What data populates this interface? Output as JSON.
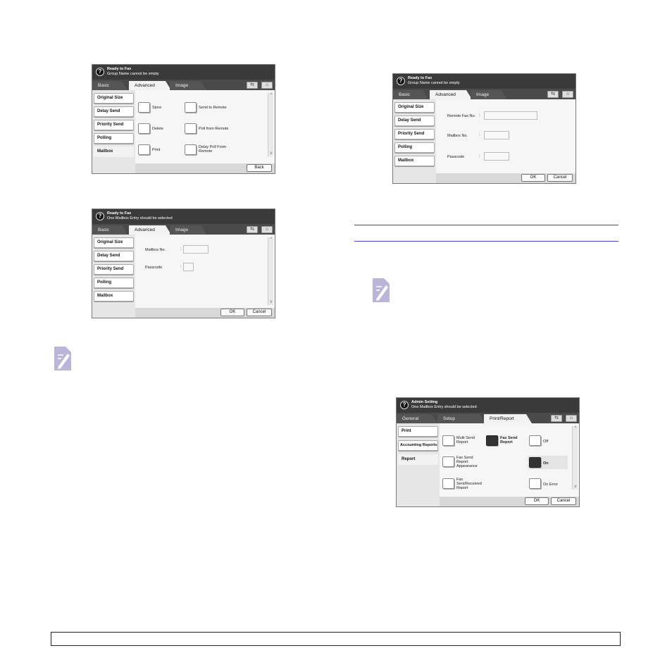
{
  "panel_a": {
    "status_title": "Ready to Fax",
    "status_message": "Group Name cannot be empty",
    "tabs": [
      "Basic",
      "Advanced",
      "Image"
    ],
    "sidebar": [
      "Original Size",
      "Delay Send",
      "Priority Send",
      "Polling",
      "Mailbox"
    ],
    "buttons": [
      "Store",
      "Send to Remote",
      "Delete",
      "Poll from Remote",
      "Print",
      "Delay Poll From Remote"
    ],
    "back": "Back"
  },
  "panel_b": {
    "status_title": "Ready to Fax",
    "status_message": "One Mailbox Entry should be selected",
    "tabs": [
      "Basic",
      "Advanced",
      "Image"
    ],
    "sidebar": [
      "Original Size",
      "Delay Send",
      "Priority Send",
      "Polling",
      "Mailbox"
    ],
    "fields": [
      "Mailbox No.",
      "Passcode"
    ],
    "ok": "OK",
    "cancel": "Cancel"
  },
  "panel_c": {
    "status_title": "Ready to Fax",
    "status_message": "Group Name cannot be empty",
    "tabs": [
      "Basic",
      "Advanced",
      "Image"
    ],
    "sidebar": [
      "Original Size",
      "Delay Send",
      "Priority Send",
      "Polling",
      "Mailbox"
    ],
    "fields": [
      "Remote Fax No.",
      "Mailbox No.",
      "Passcode"
    ],
    "ok": "OK",
    "cancel": "Cancel"
  },
  "panel_d": {
    "status_title": "Admin Setting",
    "status_message": "One Mailbox Entry should be selected",
    "tabs": [
      "General",
      "Setup",
      "Print/Report"
    ],
    "sidebar": [
      "Print",
      "Accounting Reports",
      "Report"
    ],
    "reports": [
      "Multi Send Report",
      "Fax Send Report",
      "Fax Send Report Appearance",
      "Fax Sent/Received Report"
    ],
    "options": [
      "Off",
      "On",
      "On Error"
    ],
    "ok": "OK",
    "cancel": "Cancel"
  },
  "icons": {
    "help": "?",
    "return_icon": "⇆",
    "home_icon": "⌂",
    "scroll_up": "^",
    "scroll_down": "v"
  },
  "colors": {
    "note_icon": "#b9b6d9",
    "section_rule": "#3e3ec8"
  }
}
